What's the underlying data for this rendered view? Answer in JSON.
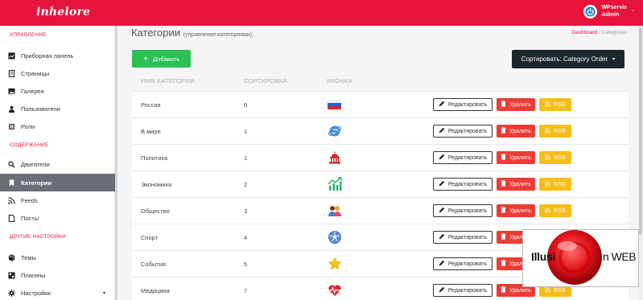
{
  "brand": {
    "logo_text": "inhelore",
    "accent": "#e6133a"
  },
  "user": {
    "name": "WPservis",
    "role": "Admin",
    "caret": "⌄"
  },
  "sidebar": {
    "sections": [
      {
        "label": "УПРАВЛЕНИЕ"
      },
      {
        "label": "СОДЕРЖАНИЕ"
      },
      {
        "label": "ДРУГИЕ НАСТРОЙКИ"
      }
    ],
    "items": [
      {
        "label": "Приборная панель",
        "icon": "dashboard-icon"
      },
      {
        "label": "Страницы",
        "icon": "pages-icon"
      },
      {
        "label": "Галерея",
        "icon": "gallery-icon"
      },
      {
        "label": "Пользователи",
        "icon": "user-icon"
      },
      {
        "label": "Роли",
        "icon": "roles-icon"
      },
      {
        "label": "Двигатели",
        "icon": "search-icon"
      },
      {
        "label": "Категории",
        "icon": "bookmark-icon",
        "active": true
      },
      {
        "label": "Feeds",
        "icon": "rss-icon"
      },
      {
        "label": "Посты",
        "icon": "posts-icon"
      },
      {
        "label": "Темы",
        "icon": "palette-icon"
      },
      {
        "label": "Плагины",
        "icon": "plugins-icon"
      },
      {
        "label": "Настройки",
        "icon": "gear-icon",
        "caret": "▾"
      }
    ]
  },
  "header": {
    "title": "Категории",
    "subtitle": "(управление категориями).",
    "breadcrumb": {
      "link": "Dashboard",
      "sep": "/",
      "current": "Categories"
    }
  },
  "toolbar": {
    "add_label": "Добавить",
    "add_icon": "+",
    "sort_label": "Сортировать: Category Order",
    "sort_caret": "▾"
  },
  "table": {
    "columns": [
      "ИМЯ КАТЕГОРИИ",
      "СОРТИРОВКА",
      "ИКОНКА"
    ],
    "edit_label": "Редактировать",
    "delete_label": "Удалить",
    "rss_label": "RSS",
    "rows": [
      {
        "name": "Россия",
        "sort": "0",
        "icon": "russia-flag-icon"
      },
      {
        "name": "В мире",
        "sort": "1",
        "icon": "world-icon"
      },
      {
        "name": "Политика",
        "sort": "1",
        "icon": "capitol-icon"
      },
      {
        "name": "Экономика",
        "sort": "2",
        "icon": "growth-chart-icon"
      },
      {
        "name": "Общество",
        "sort": "3",
        "icon": "people-icon"
      },
      {
        "name": "Спорт",
        "sort": "4",
        "icon": "soccer-ball-icon"
      },
      {
        "name": "События",
        "sort": "5",
        "icon": "star-icon"
      },
      {
        "name": "Медицина",
        "sort": "7",
        "icon": "heartbeat-icon"
      }
    ]
  },
  "watermark": {
    "text_left": "Illusi",
    "text_right": "n WEB"
  },
  "colors": {
    "green": "#2bbf54",
    "red": "#ed3b35",
    "yellow": "#f7bd18",
    "dark": "#1d262c",
    "sidebar_active": "#6a6f76"
  }
}
